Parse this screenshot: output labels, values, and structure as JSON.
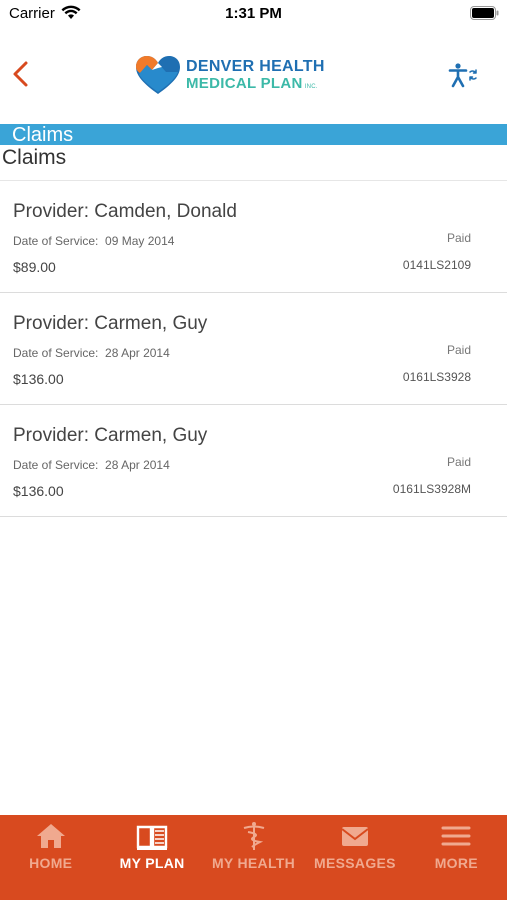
{
  "status_bar": {
    "carrier": "Carrier",
    "time": "1:31 PM"
  },
  "header": {
    "logo_line1": "DENVER HEALTH",
    "logo_line2": "MEDICAL PLAN",
    "logo_inc": "INC."
  },
  "banner": {
    "title": "Claims"
  },
  "page": {
    "title": "Claims"
  },
  "claims": [
    {
      "provider": "Provider: Camden, Donald",
      "date_label": "Date of Service:",
      "date": "09 May 2014",
      "amount": "$89.00",
      "status": "Paid",
      "claim_id": "0141LS2109"
    },
    {
      "provider": "Provider: Carmen, Guy",
      "date_label": "Date of Service:",
      "date": "28 Apr 2014",
      "amount": "$136.00",
      "status": "Paid",
      "claim_id": "0161LS3928"
    },
    {
      "provider": "Provider: Carmen, Guy",
      "date_label": "Date of Service:",
      "date": "28 Apr 2014",
      "amount": "$136.00",
      "status": "Paid",
      "claim_id": "0161LS3928M"
    }
  ],
  "tabs": [
    {
      "label": "HOME",
      "icon": "home-icon"
    },
    {
      "label": "MY PLAN",
      "icon": "book-icon"
    },
    {
      "label": "MY HEALTH",
      "icon": "caduceus-icon"
    },
    {
      "label": "MESSAGES",
      "icon": "envelope-icon"
    },
    {
      "label": "MORE",
      "icon": "menu-icon"
    }
  ],
  "colors": {
    "accent": "#d84a1f",
    "banner": "#3aa4d7",
    "logo_blue": "#1f6fb2",
    "logo_teal": "#3cb9a8"
  }
}
